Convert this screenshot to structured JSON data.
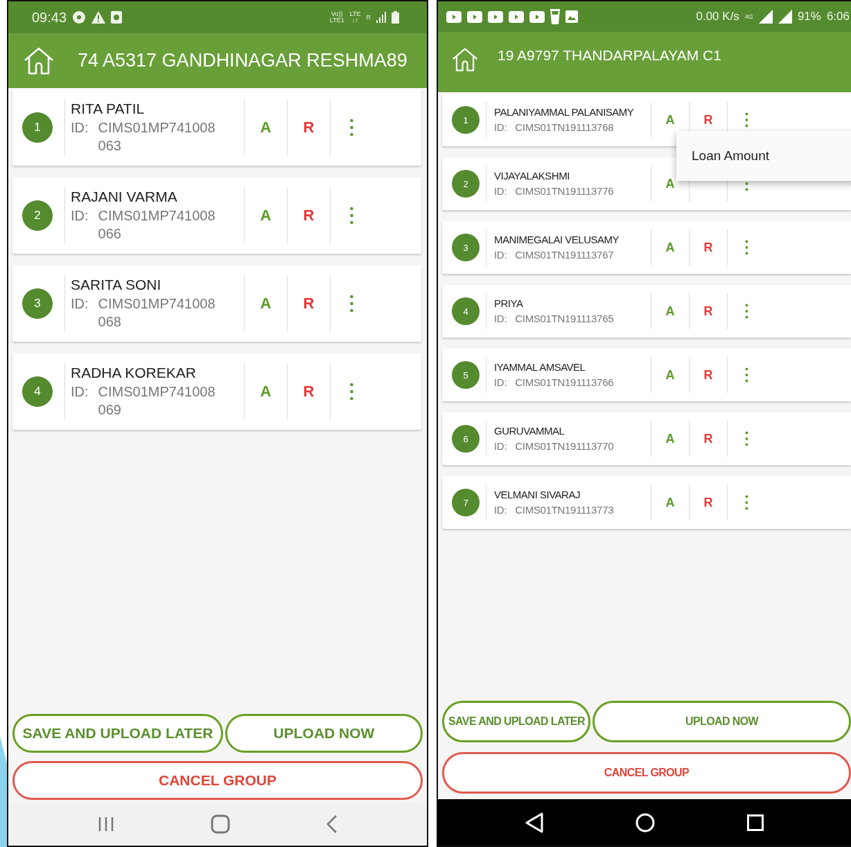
{
  "phones": [
    {
      "status_bar": {
        "time": "09:43",
        "network_labels": [
          [
            "Vo))",
            "LTE1"
          ],
          [
            "LTE",
            "↓↑"
          ],
          [
            "R"
          ]
        ]
      },
      "title": "74 A5317 GANDHINAGAR RESHMA89",
      "members": [
        {
          "number": "1",
          "name": "RITA PATIL",
          "id_label": "ID:",
          "id": "CIMS01MP741008063",
          "approve": "A",
          "reject": "R"
        },
        {
          "number": "2",
          "name": "RAJANI VARMA",
          "id_label": "ID:",
          "id": "CIMS01MP741008066",
          "approve": "A",
          "reject": "R"
        },
        {
          "number": "3",
          "name": "SARITA SONI",
          "id_label": "ID:",
          "id": "CIMS01MP741008068",
          "approve": "A",
          "reject": "R"
        },
        {
          "number": "4",
          "name": "RADHA KOREKAR",
          "id_label": "ID:",
          "id": "CIMS01MP741008069",
          "approve": "A",
          "reject": "R"
        }
      ],
      "buttons": [
        {
          "label": "SAVE AND UPLOAD LATER",
          "kind": "primary"
        },
        {
          "label": "UPLOAD NOW",
          "kind": "primary"
        },
        {
          "label": "CANCEL GROUP",
          "kind": "danger"
        }
      ]
    },
    {
      "status_bar": {
        "speed": "0.00 K/s",
        "network_labels": [
          [
            "4G"
          ]
        ],
        "battery": "91%",
        "time": "6:06"
      },
      "title": "19 A9797 THANDARPALAYAM C1",
      "members": [
        {
          "number": "1",
          "name": "PALANIYAMMAL PALANISAMY",
          "id_label": "ID:",
          "id": "CIMS01TN191113768",
          "approve": "A",
          "reject": "R"
        },
        {
          "number": "2",
          "name": "VIJAYALAKSHMI",
          "id_label": "ID:",
          "id": "CIMS01TN191113776",
          "approve": "A"
        },
        {
          "number": "3",
          "name": "MANIMEGALAI VELUSAMY",
          "id_label": "ID:",
          "id": "CIMS01TN191113767",
          "approve": "A",
          "reject": "R"
        },
        {
          "number": "4",
          "name": "PRIYA",
          "id_label": "ID:",
          "id": "CIMS01TN191113765",
          "approve": "A",
          "reject": "R"
        },
        {
          "number": "5",
          "name": "IYAMMAL AMSAVEL",
          "id_label": "ID:",
          "id": "CIMS01TN191113766",
          "approve": "A",
          "reject": "R"
        },
        {
          "number": "6",
          "name": "GURUVAMMAL",
          "id_label": "ID:",
          "id": "CIMS01TN191113770",
          "approve": "A",
          "reject": "R"
        },
        {
          "number": "7",
          "name": "VELMANI SIVARAJ",
          "id_label": "ID:",
          "id": "CIMS01TN191113773",
          "approve": "A",
          "reject": "R"
        }
      ],
      "popup_menu": {
        "items": [
          "Loan Amount"
        ]
      },
      "buttons": [
        {
          "label": "SAVE AND UPLOAD LATER",
          "kind": "primary"
        },
        {
          "label": "UPLOAD NOW",
          "kind": "primary"
        },
        {
          "label": "CANCEL GROUP",
          "kind": "danger"
        }
      ]
    }
  ]
}
